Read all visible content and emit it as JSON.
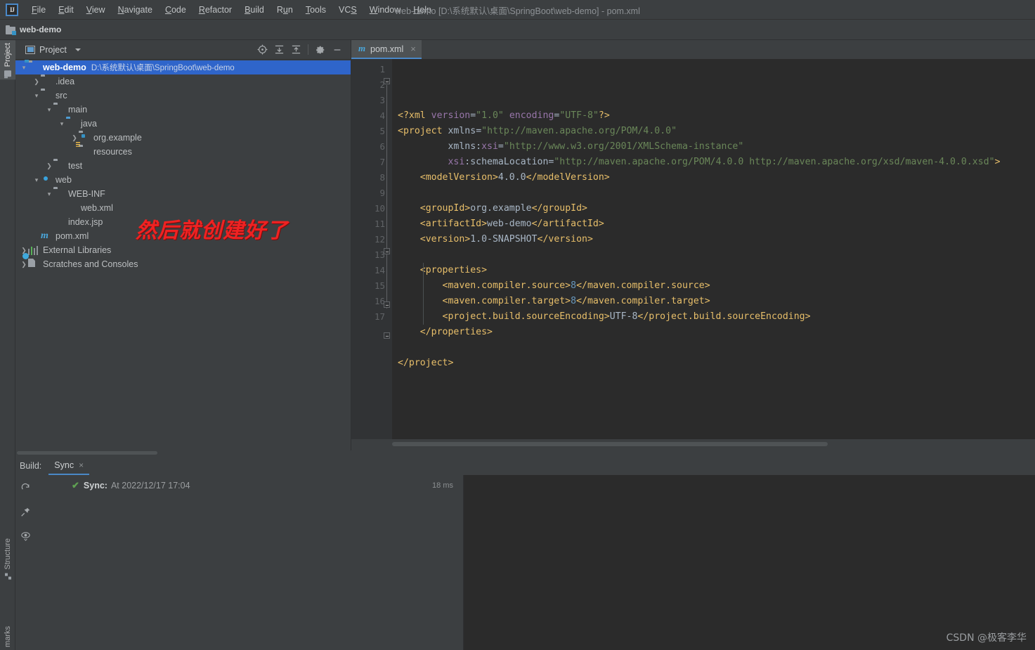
{
  "window": {
    "title": "web-demo [D:\\系统默认\\桌面\\SpringBoot\\web-demo] - pom.xml",
    "logo": "IJ"
  },
  "menubar": {
    "items": [
      {
        "label": "File"
      },
      {
        "label": "Edit"
      },
      {
        "label": "View"
      },
      {
        "label": "Navigate"
      },
      {
        "label": "Code"
      },
      {
        "label": "Refactor"
      },
      {
        "label": "Build"
      },
      {
        "label": "Run"
      },
      {
        "label": "Tools"
      },
      {
        "label": "VCS"
      },
      {
        "label": "Window"
      },
      {
        "label": "Help"
      }
    ]
  },
  "breadcrumb": {
    "project": "web-demo"
  },
  "left_tool_strip": {
    "project_tab": "Project",
    "structure_tab": "Structure",
    "bookmarks_tab": "marks"
  },
  "project_panel": {
    "title": "Project",
    "tools": [
      {
        "name": "select-opened-file-icon",
        "glyph": "⊕"
      },
      {
        "name": "expand-all-icon",
        "glyph": "⇟"
      },
      {
        "name": "collapse-all-icon",
        "glyph": "⇡"
      },
      {
        "name": "settings-gear-icon",
        "glyph": "⚙"
      },
      {
        "name": "hide-icon",
        "glyph": "—"
      }
    ],
    "tree": [
      {
        "label": "web-demo",
        "path": "D:\\系统默认\\桌面\\SpringBoot\\web-demo",
        "indent": 0,
        "arrow": "v",
        "icon": "module-folder",
        "selected": true,
        "bold": true
      },
      {
        "label": ".idea",
        "path": "",
        "indent": 1,
        "arrow": ">",
        "icon": "folder",
        "selected": false,
        "bold": false
      },
      {
        "label": "src",
        "path": "",
        "indent": 1,
        "arrow": "v",
        "icon": "folder",
        "selected": false,
        "bold": false
      },
      {
        "label": "main",
        "path": "",
        "indent": 2,
        "arrow": "v",
        "icon": "folder",
        "selected": false,
        "bold": false
      },
      {
        "label": "java",
        "path": "",
        "indent": 3,
        "arrow": "v",
        "icon": "source-folder",
        "selected": false,
        "bold": false
      },
      {
        "label": "org.example",
        "path": "",
        "indent": 4,
        "arrow": ">",
        "icon": "package",
        "selected": false,
        "bold": false
      },
      {
        "label": "resources",
        "path": "",
        "indent": 4,
        "arrow": "",
        "icon": "resources-folder",
        "selected": false,
        "bold": false
      },
      {
        "label": "test",
        "path": "",
        "indent": 2,
        "arrow": ">",
        "icon": "folder",
        "selected": false,
        "bold": false
      },
      {
        "label": "web",
        "path": "",
        "indent": 1,
        "arrow": "v",
        "icon": "web-folder",
        "selected": false,
        "bold": false
      },
      {
        "label": "WEB-INF",
        "path": "",
        "indent": 2,
        "arrow": "v",
        "icon": "folder",
        "selected": false,
        "bold": false
      },
      {
        "label": "web.xml",
        "path": "",
        "indent": 3,
        "arrow": "",
        "icon": "xml-file",
        "selected": false,
        "bold": false
      },
      {
        "label": "index.jsp",
        "path": "",
        "indent": 2,
        "arrow": "",
        "icon": "jsp-file",
        "selected": false,
        "bold": false
      },
      {
        "label": "pom.xml",
        "path": "",
        "indent": 1,
        "arrow": "",
        "icon": "maven-file",
        "selected": false,
        "bold": false
      },
      {
        "label": "External Libraries",
        "path": "",
        "indent": 0,
        "arrow": ">",
        "icon": "libraries",
        "selected": false,
        "bold": false
      },
      {
        "label": "Scratches and Consoles",
        "path": "",
        "indent": 0,
        "arrow": ">",
        "icon": "scratches",
        "selected": false,
        "bold": false
      }
    ]
  },
  "annotation": {
    "text": "然后就创建好了",
    "color": "#ef2222"
  },
  "editor": {
    "tab": {
      "label": "pom.xml",
      "icon": "maven-icon",
      "close": "×"
    },
    "line_numbers": [
      1,
      2,
      3,
      4,
      5,
      6,
      7,
      8,
      9,
      10,
      11,
      12,
      13,
      14,
      15,
      16,
      17
    ],
    "lines": [
      {
        "n": 1,
        "segments": [
          {
            "t": "<?xml ",
            "c": "tg"
          },
          {
            "t": "version",
            "c": "at"
          },
          {
            "t": "=",
            "c": "pl"
          },
          {
            "t": "\"1.0\"",
            "c": "st"
          },
          {
            "t": " ",
            "c": "pl"
          },
          {
            "t": "encoding",
            "c": "at"
          },
          {
            "t": "=",
            "c": "pl"
          },
          {
            "t": "\"UTF-8\"",
            "c": "st"
          },
          {
            "t": "?>",
            "c": "tg"
          }
        ]
      },
      {
        "n": 2,
        "segments": [
          {
            "t": "<project",
            "c": "tg"
          },
          {
            "t": " ",
            "c": "pl"
          },
          {
            "t": "xmlns",
            "c": "tx"
          },
          {
            "t": "=",
            "c": "pl"
          },
          {
            "t": "\"http://maven.apache.org/POM/4.0.0\"",
            "c": "st"
          }
        ]
      },
      {
        "n": 3,
        "segments": [
          {
            "t": "         xmlns:",
            "c": "tx"
          },
          {
            "t": "xsi",
            "c": "at"
          },
          {
            "t": "=",
            "c": "pl"
          },
          {
            "t": "\"http://www.w3.org/2001/XMLSchema-instance\"",
            "c": "st"
          }
        ]
      },
      {
        "n": 4,
        "segments": [
          {
            "t": "         ",
            "c": "pl"
          },
          {
            "t": "xsi",
            "c": "at"
          },
          {
            "t": ":schemaLocation",
            "c": "tx"
          },
          {
            "t": "=",
            "c": "pl"
          },
          {
            "t": "\"http://maven.apache.org/POM/4.0.0 http://maven.apache.org/xsd/maven-4.0.0.xsd\"",
            "c": "st"
          },
          {
            "t": ">",
            "c": "tg"
          }
        ]
      },
      {
        "n": 5,
        "segments": [
          {
            "t": "    <modelVersion>",
            "c": "tg"
          },
          {
            "t": "4.0.0",
            "c": "tx"
          },
          {
            "t": "</modelVersion>",
            "c": "tg"
          }
        ]
      },
      {
        "n": 6,
        "segments": []
      },
      {
        "n": 7,
        "segments": [
          {
            "t": "    <groupId>",
            "c": "tg"
          },
          {
            "t": "org.example",
            "c": "tx"
          },
          {
            "t": "</groupId>",
            "c": "tg"
          }
        ]
      },
      {
        "n": 8,
        "segments": [
          {
            "t": "    <artifactId>",
            "c": "tg"
          },
          {
            "t": "web-demo",
            "c": "tx"
          },
          {
            "t": "</artifactId>",
            "c": "tg"
          }
        ]
      },
      {
        "n": 9,
        "segments": [
          {
            "t": "    <version>",
            "c": "tg"
          },
          {
            "t": "1.0-SNAPSHOT",
            "c": "tx"
          },
          {
            "t": "</version>",
            "c": "tg"
          }
        ]
      },
      {
        "n": 10,
        "segments": []
      },
      {
        "n": 11,
        "segments": [
          {
            "t": "    <properties>",
            "c": "tg"
          }
        ]
      },
      {
        "n": 12,
        "segments": [
          {
            "t": "        <maven.compiler.source>",
            "c": "tg"
          },
          {
            "t": "8",
            "c": "nm2"
          },
          {
            "t": "</maven.compiler.source>",
            "c": "tg"
          }
        ]
      },
      {
        "n": 13,
        "segments": [
          {
            "t": "        <maven.compiler.target>",
            "c": "tg"
          },
          {
            "t": "8",
            "c": "nm2"
          },
          {
            "t": "</maven.compiler.target>",
            "c": "tg"
          }
        ]
      },
      {
        "n": 14,
        "segments": [
          {
            "t": "        <project.build.sourceEncoding>",
            "c": "tg"
          },
          {
            "t": "UTF-8",
            "c": "tx"
          },
          {
            "t": "</project.build.sourceEncoding>",
            "c": "tg"
          }
        ]
      },
      {
        "n": 15,
        "segments": [
          {
            "t": "    </properties>",
            "c": "tg"
          }
        ]
      },
      {
        "n": 16,
        "segments": []
      },
      {
        "n": 17,
        "segments": [
          {
            "t": "</project>",
            "c": "tg"
          }
        ]
      }
    ]
  },
  "build_panel": {
    "label": "Build:",
    "tab": "Sync",
    "tab_close": "×",
    "side_icons": [
      {
        "name": "rerun-icon",
        "glyph": "⟳"
      },
      {
        "name": "pin-icon",
        "glyph": "📌"
      },
      {
        "name": "eye-filter-icon",
        "glyph": "👁"
      }
    ],
    "rows": [
      {
        "status": "✔",
        "name": "Sync:",
        "message": "At 2022/12/17 17:04",
        "time": "18 ms"
      }
    ]
  },
  "watermark": "CSDN @极客李华",
  "colors": {
    "panel_bg": "#3c3f41",
    "editor_bg": "#2b2b2b",
    "gutter_bg": "#313335",
    "selection": "#2f65ca",
    "accent": "#4a88c7",
    "tag": "#e8bf6a",
    "string": "#6a8759",
    "attr": "#9876aa",
    "text": "#a9b7c6",
    "number": "#6897bb",
    "success": "#5fa052"
  }
}
